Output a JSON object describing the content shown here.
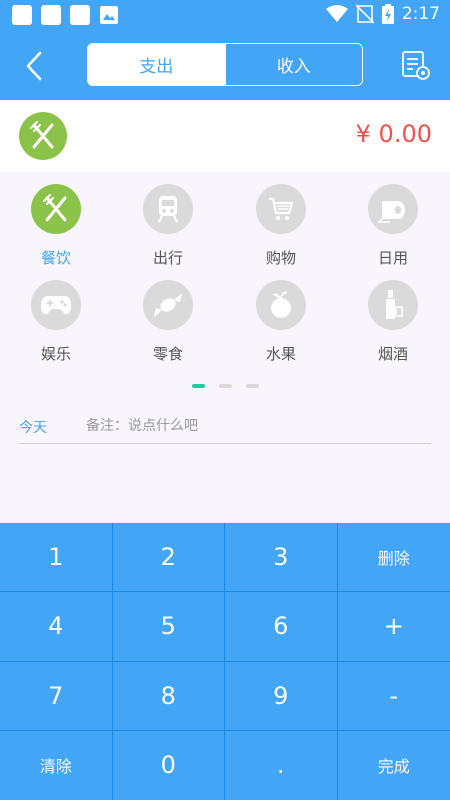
{
  "status_bar": {
    "time": "2:17",
    "icons": [
      "notification-square-icon",
      "notification-square-icon",
      "notification-square-icon",
      "image-icon",
      "wifi-icon",
      "no-sim-icon",
      "battery-charging-icon"
    ]
  },
  "header": {
    "back_icon": "chevron-left-icon",
    "tabs": [
      {
        "label": "支出",
        "active": true
      },
      {
        "label": "收入",
        "active": false
      }
    ],
    "budget_icon": "list-settings-icon"
  },
  "amount": {
    "icon": "fork-knife-icon",
    "value": "¥ 0.00",
    "color": "#ef5350"
  },
  "categories": [
    {
      "label": "餐饮",
      "icon": "fork-knife-icon",
      "selected": true
    },
    {
      "label": "出行",
      "icon": "train-icon",
      "selected": false
    },
    {
      "label": "购物",
      "icon": "cart-icon",
      "selected": false
    },
    {
      "label": "日用",
      "icon": "tissue-roll-icon",
      "selected": false
    },
    {
      "label": "娱乐",
      "icon": "gamepad-icon",
      "selected": false
    },
    {
      "label": "零食",
      "icon": "candy-icon",
      "selected": false
    },
    {
      "label": "水果",
      "icon": "apple-icon",
      "selected": false
    },
    {
      "label": "烟酒",
      "icon": "bottle-icon",
      "selected": false
    }
  ],
  "pager": {
    "pages": 3,
    "current": 1
  },
  "memo": {
    "date": "今天",
    "placeholder": "备注：说点什么吧",
    "value": ""
  },
  "keypad": {
    "keys": [
      "1",
      "2",
      "3",
      "删除",
      "4",
      "5",
      "6",
      "+",
      "7",
      "8",
      "9",
      "-",
      "清除",
      "0",
      ".",
      "完成"
    ]
  },
  "colors": {
    "primary": "#42a5f5",
    "selected_category": "#8bc34a",
    "amount": "#ef5350",
    "pager_active": "#26c6a0"
  }
}
